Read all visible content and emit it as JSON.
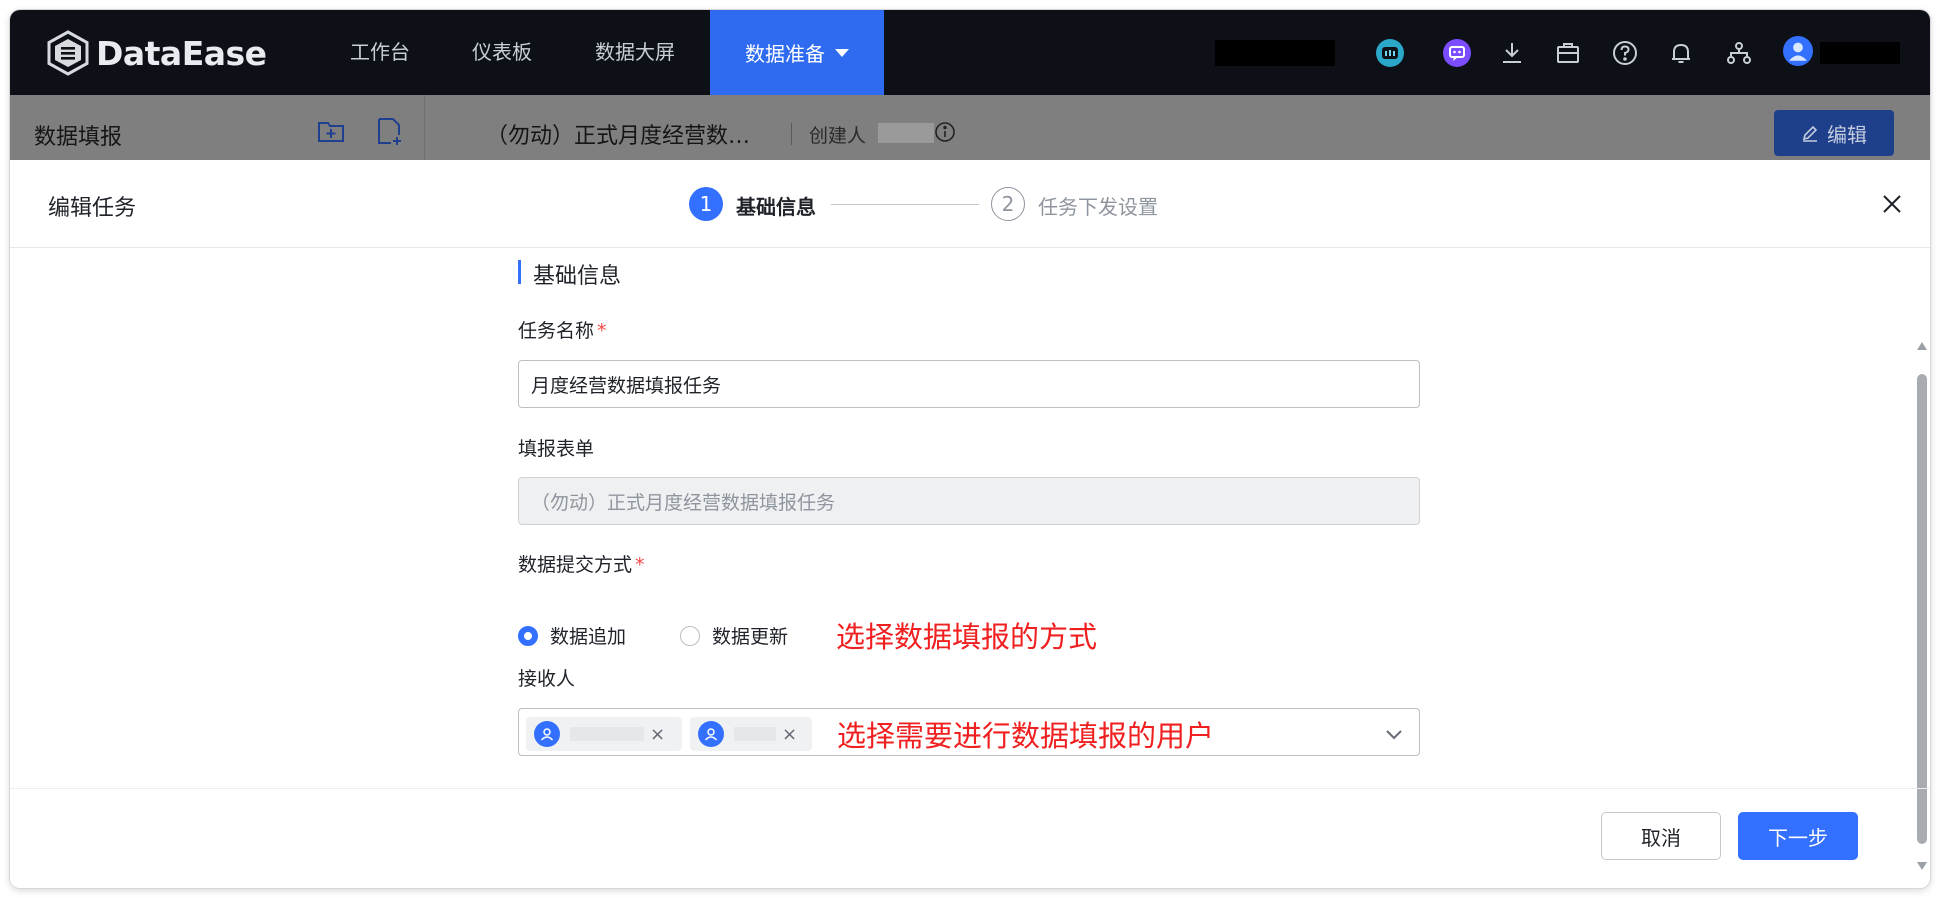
{
  "topbar": {
    "brand": "DataEase",
    "nav": [
      "工作台",
      "仪表板",
      "数据大屏"
    ],
    "nav_active": "数据准备"
  },
  "subbar": {
    "section_title": "数据填报",
    "page_heading": "（勿动）正式月度经营数…",
    "creator_label": "创建人",
    "edit_label": "编辑"
  },
  "drawer": {
    "title": "编辑任务",
    "steps": [
      {
        "number": "1",
        "label": "基础信息"
      },
      {
        "number": "2",
        "label": "任务下发设置"
      }
    ]
  },
  "form": {
    "section_title": "基础信息",
    "task_name_label": "任务名称",
    "task_name_value": "月度经营数据填报任务",
    "form_label": "填报表单",
    "form_value": "（勿动）正式月度经营数据填报任务",
    "submit_mode_label": "数据提交方式",
    "submit_options": [
      "数据追加",
      "数据更新"
    ],
    "submit_selected": "数据追加",
    "receiver_label": "接收人",
    "required_mark": "*"
  },
  "annotations": {
    "submit_mode": "选择数据填报的方式",
    "receiver": "选择需要进行数据填报的用户"
  },
  "footer": {
    "cancel": "取消",
    "next": "下一步"
  },
  "colors": {
    "primary": "#3370ff",
    "annotation": "#f02020",
    "topbar": "#0d1117"
  }
}
